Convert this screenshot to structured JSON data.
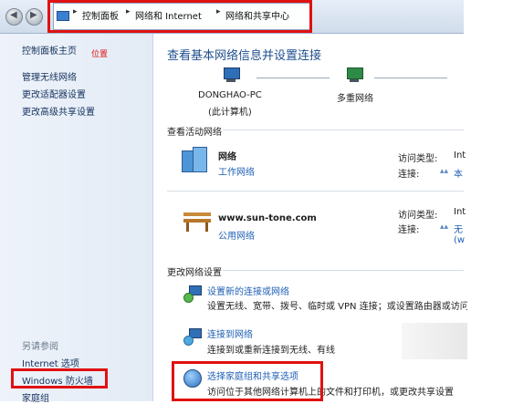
{
  "address_bar": {
    "crumbs": [
      "控制面板",
      "网络和 Internet",
      "网络和共享中心"
    ]
  },
  "sidebar": {
    "home": "控制面板主页",
    "home_annotation": "位置",
    "items": [
      "管理无线网络",
      "更改适配器设置",
      "更改高级共享设置"
    ],
    "see_also_header": "另请参阅",
    "see_also": [
      "Internet 选项",
      "Windows 防火墙",
      "家庭组"
    ]
  },
  "main": {
    "title": "查看基本网络信息并设置连接",
    "map": {
      "computer_name": "DONGHAO-PC",
      "computer_sub": "(此计算机)",
      "network_label": "多重网络"
    },
    "active_header": "查看活动网络",
    "networks": [
      {
        "name": "网络",
        "type": "工作网络",
        "access_label": "访问类型:",
        "access_value": "Int",
        "conn_label": "连接:",
        "conn_value": "本"
      },
      {
        "name": "www.sun-tone.com",
        "type": "公用网络",
        "access_label": "访问类型:",
        "access_value": "Int",
        "conn_label": "连接:",
        "conn_value": "无",
        "conn_extra": "(w"
      }
    ],
    "change_header": "更改网络设置",
    "tasks": [
      {
        "title": "设置新的连接或网络",
        "desc": "设置无线、宽带、拨号、临时或 VPN 连接；或设置路由器或访问"
      },
      {
        "title": "连接到网络",
        "desc": "连接到或重新连接到无线、有线"
      },
      {
        "title": "选择家庭组和共享选项",
        "desc": "访问位于其他网络计算机上的文件和打印机，或更改共享设置"
      }
    ]
  },
  "colors": {
    "link": "#1e5fb4",
    "highlight": "#e01111"
  }
}
